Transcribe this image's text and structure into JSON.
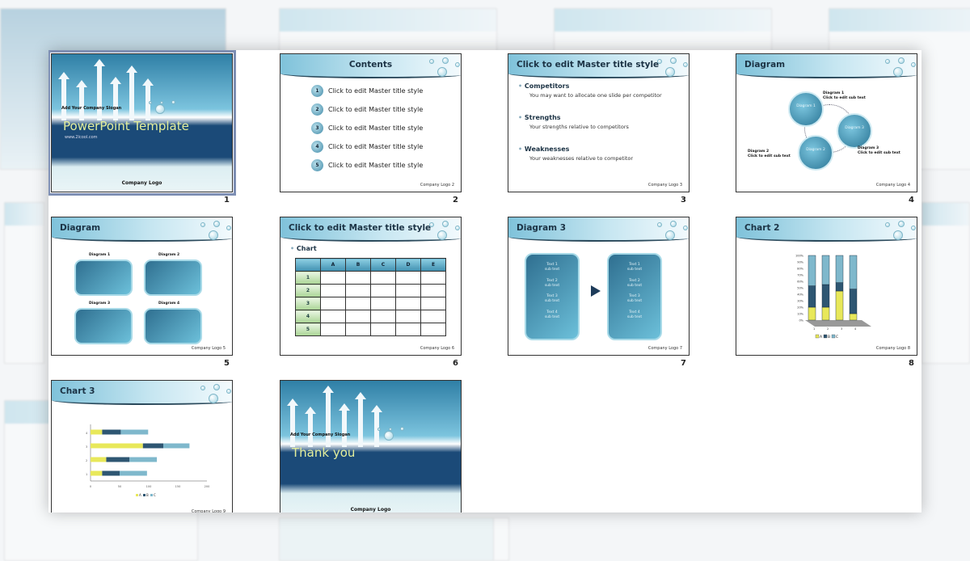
{
  "slides": [
    {
      "number": "1",
      "type": "cover",
      "slogan": "Add Your Company Slogan",
      "title": "PowerPoint Template",
      "url": "www.2lcool.com",
      "logo": "Company Logo",
      "selected": true
    },
    {
      "number": "2",
      "type": "contents",
      "title": "Contents",
      "items": [
        "Click to edit Master title style",
        "Click to edit Master title style",
        "Click to edit Master title style",
        "Click to edit Master title style",
        "Click to edit Master title style"
      ],
      "footer": "Company Logo"
    },
    {
      "number": "3",
      "type": "bullets",
      "title": "Click to edit Master title style",
      "bullets": [
        {
          "head": "Competitors",
          "text": "You may want to allocate one slide per competitor"
        },
        {
          "head": "Strengths",
          "text": "Your strengths relative to competitors"
        },
        {
          "head": "Weaknesses",
          "text": "Your weaknesses relative to competitor"
        }
      ],
      "footer": "Company Logo"
    },
    {
      "number": "4",
      "type": "cycle",
      "title": "Diagram",
      "circles": [
        "Diagram 1",
        "Diagram 2",
        "Diagram 3"
      ],
      "captions": [
        "Diagram 1\nClick to edit sub text",
        "Diagram 2\nClick to edit sub text",
        "Diagram 3\nClick to edit sub text"
      ],
      "footer": "Company Logo"
    },
    {
      "number": "5",
      "type": "boxes",
      "title": "Diagram",
      "labels": [
        "Diagram 1",
        "Diagram 2",
        "Diagram 3",
        "Diagram 4"
      ],
      "footer": "Company Logo"
    },
    {
      "number": "6",
      "type": "table",
      "title": "Click to edit Master title style",
      "bullet": "Chart",
      "columns": [
        "",
        "A",
        "B",
        "C",
        "D",
        "E"
      ],
      "rows": [
        "1",
        "2",
        "3",
        "4",
        "5"
      ],
      "footer": "Company Logo"
    },
    {
      "number": "7",
      "type": "flow",
      "title": "Diagram 3",
      "left": [
        "Text 1\nsub text",
        "Text 2\nsub text",
        "Text 3\nsub text",
        "Text 4\nsub text"
      ],
      "right": [
        "Text 1\nsub text",
        "Text 2\nsub text",
        "Text 3\nsub text",
        "Text 4\nsub text"
      ],
      "footer": "Company Logo"
    },
    {
      "number": "8",
      "type": "chart2",
      "title": "Chart 2",
      "footer": "Company Logo"
    },
    {
      "number": "9",
      "type": "chart3",
      "title": "Chart 3",
      "footer": "Company Logo"
    },
    {
      "number": "10",
      "type": "thanks",
      "slogan": "Add Your Company Slogan",
      "title": "Thank you",
      "logo": "Company Logo"
    }
  ],
  "colors": {
    "series_a": "#e8e85a",
    "series_b": "#2e5672",
    "series_c": "#7fb8cc",
    "header": "#7fc2da"
  },
  "chart_data": [
    {
      "type": "bar",
      "stacked": "percent",
      "slide": "Chart 2",
      "categories": [
        "1",
        "2",
        "3",
        "4"
      ],
      "ytick_labels": [
        "0%",
        "10%",
        "20%",
        "30%",
        "40%",
        "50%",
        "60%",
        "70%",
        "80%",
        "90%",
        "100%"
      ],
      "ylim": [
        0,
        100
      ],
      "legend": "bottom",
      "series": [
        {
          "name": "A",
          "values": [
            20,
            20,
            45,
            10
          ]
        },
        {
          "name": "B",
          "values": [
            33,
            35,
            13,
            38
          ]
        },
        {
          "name": "C",
          "values": [
            47,
            45,
            42,
            52
          ]
        }
      ]
    },
    {
      "type": "bar",
      "orientation": "horizontal",
      "stacked": true,
      "slide": "Chart 3",
      "categories": [
        "1",
        "2",
        "3",
        "4"
      ],
      "xtick_labels": [
        "0",
        "50",
        "100",
        "150",
        "200"
      ],
      "xlim": [
        0,
        200
      ],
      "legend": "bottom",
      "series": [
        {
          "name": "A",
          "values": [
            20,
            27,
            90,
            20
          ]
        },
        {
          "name": "B",
          "values": [
            30,
            40,
            35,
            32
          ]
        },
        {
          "name": "C",
          "values": [
            47,
            47,
            45,
            47
          ]
        }
      ]
    }
  ]
}
